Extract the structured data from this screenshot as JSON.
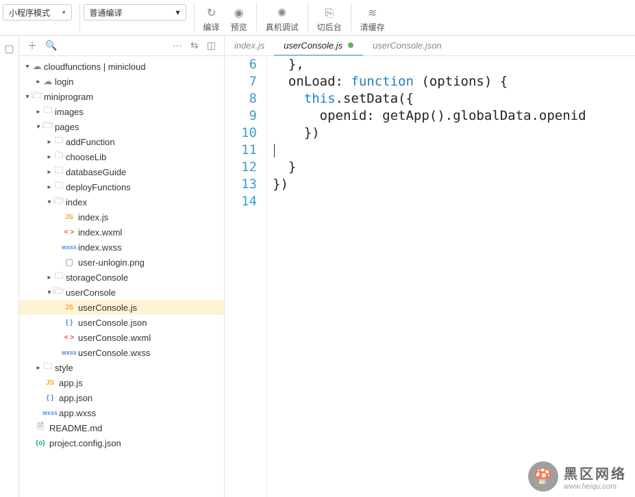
{
  "toolbar": {
    "mode_select": "小程序模式",
    "compile_select": "普通编译",
    "compile": "编译",
    "preview": "预览",
    "remote_debug": "真机调试",
    "background": "切后台",
    "clear_cache": "清缓存"
  },
  "tree": {
    "root1": "cloudfunctions | minicloud",
    "login": "login",
    "miniprogram": "miniprogram",
    "images": "images",
    "pages": "pages",
    "addFunction": "addFunction",
    "chooseLib": "chooseLib",
    "databaseGuide": "databaseGuide",
    "deployFunctions": "deployFunctions",
    "index": "index",
    "index_js": "index.js",
    "index_wxml": "index.wxml",
    "index_wxss": "index.wxss",
    "user_unlogin": "user-unlogin.png",
    "storageConsole": "storageConsole",
    "userConsole": "userConsole",
    "userConsole_js": "userConsole.js",
    "userConsole_json": "userConsole.json",
    "userConsole_wxml": "userConsole.wxml",
    "userConsole_wxss": "userConsole.wxss",
    "style": "style",
    "app_js": "app.js",
    "app_json": "app.json",
    "app_wxss": "app.wxss",
    "readme": "README.md",
    "project_config": "project.config.json"
  },
  "tabs": {
    "t1": "index.js",
    "t2": "userConsole.js",
    "t3": "userConsole.json"
  },
  "code": {
    "lines": [
      "6",
      "7",
      "8",
      "9",
      "10",
      "11",
      "12",
      "13",
      "14"
    ],
    "l6": "  },",
    "l7": "",
    "l8_a": "  onLoad: ",
    "l8_b": "function",
    "l8_c": " (options) {",
    "l9_a": "    ",
    "l9_b": "this",
    "l9_c": ".setData({",
    "l10": "      openid: getApp().globalData.openid",
    "l11": "    })",
    "l12": "",
    "l13": "  }",
    "l14": "})"
  },
  "watermark": {
    "main": "黑区网络",
    "sub": "www.heiqu.com"
  },
  "badges": {
    "js": "JS",
    "json": "{ }",
    "wxml": "< >",
    "wxss": "wxss",
    "jsonc": "{o}"
  }
}
